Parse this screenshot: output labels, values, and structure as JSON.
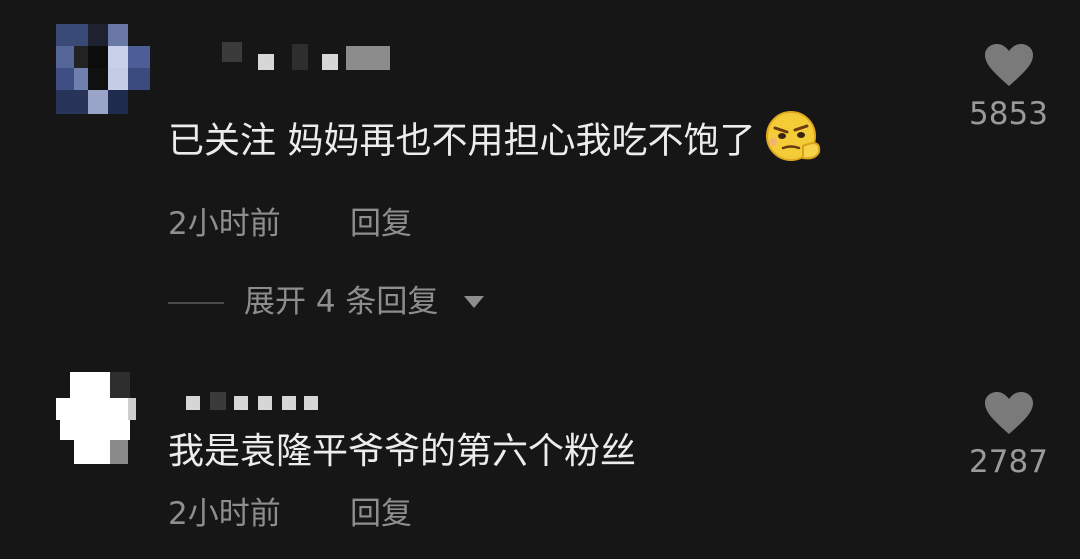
{
  "comments": [
    {
      "text": "已关注 妈妈再也不用担心我吃不饱了",
      "emoji": "thinking-emoji",
      "time": "2小时前",
      "reply_label": "回复",
      "likes": "5853",
      "expand_label": "展开 4 条回复"
    },
    {
      "text": "我是袁隆平爷爷的第六个粉丝",
      "time": "2小时前",
      "reply_label": "回复",
      "likes": "2787"
    }
  ],
  "colors": {
    "background": "#161616",
    "text": "#ececec",
    "muted": "#8e8e8e",
    "heart": "#7a7a7a"
  }
}
